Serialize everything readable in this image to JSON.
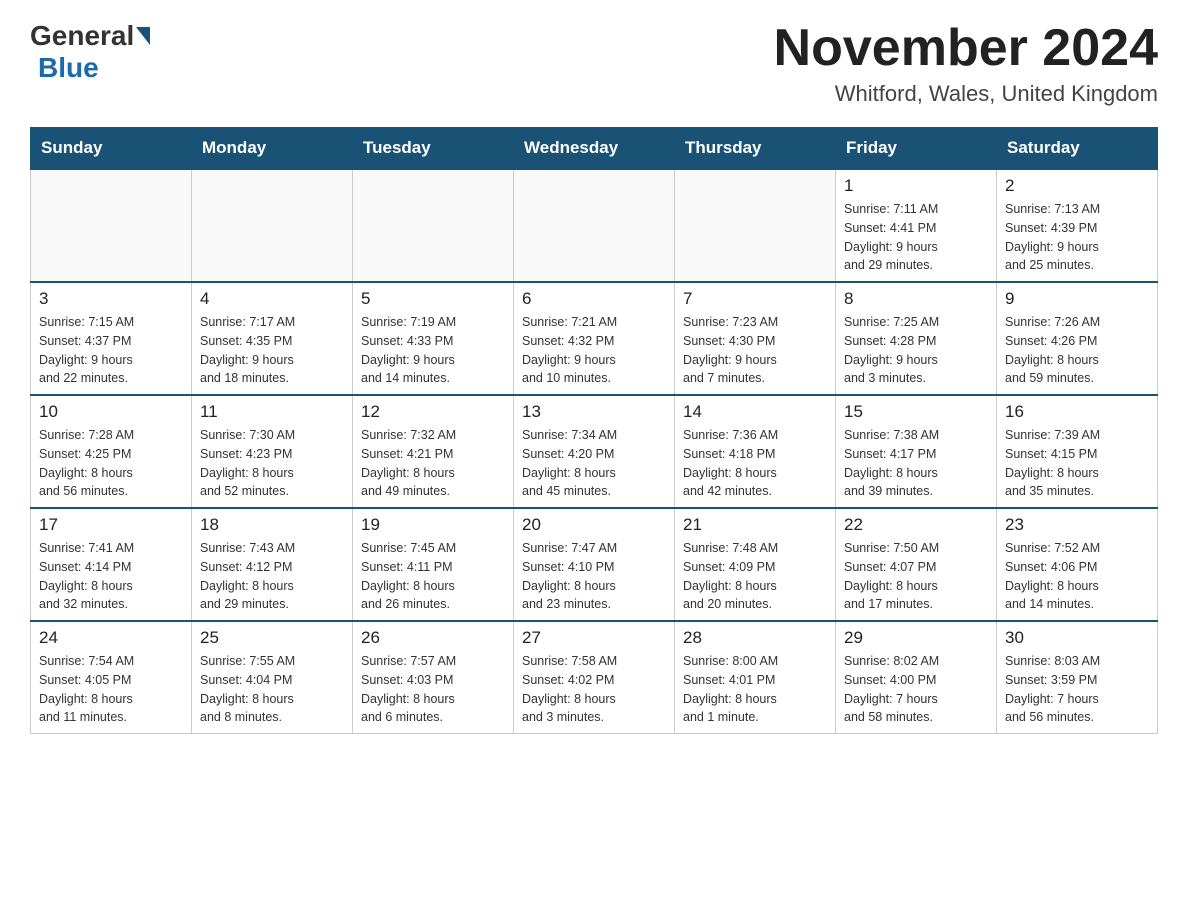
{
  "header": {
    "logo_general": "General",
    "logo_blue": "Blue",
    "title": "November 2024",
    "location": "Whitford, Wales, United Kingdom"
  },
  "weekdays": [
    "Sunday",
    "Monday",
    "Tuesday",
    "Wednesday",
    "Thursday",
    "Friday",
    "Saturday"
  ],
  "weeks": [
    [
      {
        "day": "",
        "info": ""
      },
      {
        "day": "",
        "info": ""
      },
      {
        "day": "",
        "info": ""
      },
      {
        "day": "",
        "info": ""
      },
      {
        "day": "",
        "info": ""
      },
      {
        "day": "1",
        "info": "Sunrise: 7:11 AM\nSunset: 4:41 PM\nDaylight: 9 hours\nand 29 minutes."
      },
      {
        "day": "2",
        "info": "Sunrise: 7:13 AM\nSunset: 4:39 PM\nDaylight: 9 hours\nand 25 minutes."
      }
    ],
    [
      {
        "day": "3",
        "info": "Sunrise: 7:15 AM\nSunset: 4:37 PM\nDaylight: 9 hours\nand 22 minutes."
      },
      {
        "day": "4",
        "info": "Sunrise: 7:17 AM\nSunset: 4:35 PM\nDaylight: 9 hours\nand 18 minutes."
      },
      {
        "day": "5",
        "info": "Sunrise: 7:19 AM\nSunset: 4:33 PM\nDaylight: 9 hours\nand 14 minutes."
      },
      {
        "day": "6",
        "info": "Sunrise: 7:21 AM\nSunset: 4:32 PM\nDaylight: 9 hours\nand 10 minutes."
      },
      {
        "day": "7",
        "info": "Sunrise: 7:23 AM\nSunset: 4:30 PM\nDaylight: 9 hours\nand 7 minutes."
      },
      {
        "day": "8",
        "info": "Sunrise: 7:25 AM\nSunset: 4:28 PM\nDaylight: 9 hours\nand 3 minutes."
      },
      {
        "day": "9",
        "info": "Sunrise: 7:26 AM\nSunset: 4:26 PM\nDaylight: 8 hours\nand 59 minutes."
      }
    ],
    [
      {
        "day": "10",
        "info": "Sunrise: 7:28 AM\nSunset: 4:25 PM\nDaylight: 8 hours\nand 56 minutes."
      },
      {
        "day": "11",
        "info": "Sunrise: 7:30 AM\nSunset: 4:23 PM\nDaylight: 8 hours\nand 52 minutes."
      },
      {
        "day": "12",
        "info": "Sunrise: 7:32 AM\nSunset: 4:21 PM\nDaylight: 8 hours\nand 49 minutes."
      },
      {
        "day": "13",
        "info": "Sunrise: 7:34 AM\nSunset: 4:20 PM\nDaylight: 8 hours\nand 45 minutes."
      },
      {
        "day": "14",
        "info": "Sunrise: 7:36 AM\nSunset: 4:18 PM\nDaylight: 8 hours\nand 42 minutes."
      },
      {
        "day": "15",
        "info": "Sunrise: 7:38 AM\nSunset: 4:17 PM\nDaylight: 8 hours\nand 39 minutes."
      },
      {
        "day": "16",
        "info": "Sunrise: 7:39 AM\nSunset: 4:15 PM\nDaylight: 8 hours\nand 35 minutes."
      }
    ],
    [
      {
        "day": "17",
        "info": "Sunrise: 7:41 AM\nSunset: 4:14 PM\nDaylight: 8 hours\nand 32 minutes."
      },
      {
        "day": "18",
        "info": "Sunrise: 7:43 AM\nSunset: 4:12 PM\nDaylight: 8 hours\nand 29 minutes."
      },
      {
        "day": "19",
        "info": "Sunrise: 7:45 AM\nSunset: 4:11 PM\nDaylight: 8 hours\nand 26 minutes."
      },
      {
        "day": "20",
        "info": "Sunrise: 7:47 AM\nSunset: 4:10 PM\nDaylight: 8 hours\nand 23 minutes."
      },
      {
        "day": "21",
        "info": "Sunrise: 7:48 AM\nSunset: 4:09 PM\nDaylight: 8 hours\nand 20 minutes."
      },
      {
        "day": "22",
        "info": "Sunrise: 7:50 AM\nSunset: 4:07 PM\nDaylight: 8 hours\nand 17 minutes."
      },
      {
        "day": "23",
        "info": "Sunrise: 7:52 AM\nSunset: 4:06 PM\nDaylight: 8 hours\nand 14 minutes."
      }
    ],
    [
      {
        "day": "24",
        "info": "Sunrise: 7:54 AM\nSunset: 4:05 PM\nDaylight: 8 hours\nand 11 minutes."
      },
      {
        "day": "25",
        "info": "Sunrise: 7:55 AM\nSunset: 4:04 PM\nDaylight: 8 hours\nand 8 minutes."
      },
      {
        "day": "26",
        "info": "Sunrise: 7:57 AM\nSunset: 4:03 PM\nDaylight: 8 hours\nand 6 minutes."
      },
      {
        "day": "27",
        "info": "Sunrise: 7:58 AM\nSunset: 4:02 PM\nDaylight: 8 hours\nand 3 minutes."
      },
      {
        "day": "28",
        "info": "Sunrise: 8:00 AM\nSunset: 4:01 PM\nDaylight: 8 hours\nand 1 minute."
      },
      {
        "day": "29",
        "info": "Sunrise: 8:02 AM\nSunset: 4:00 PM\nDaylight: 7 hours\nand 58 minutes."
      },
      {
        "day": "30",
        "info": "Sunrise: 8:03 AM\nSunset: 3:59 PM\nDaylight: 7 hours\nand 56 minutes."
      }
    ]
  ]
}
